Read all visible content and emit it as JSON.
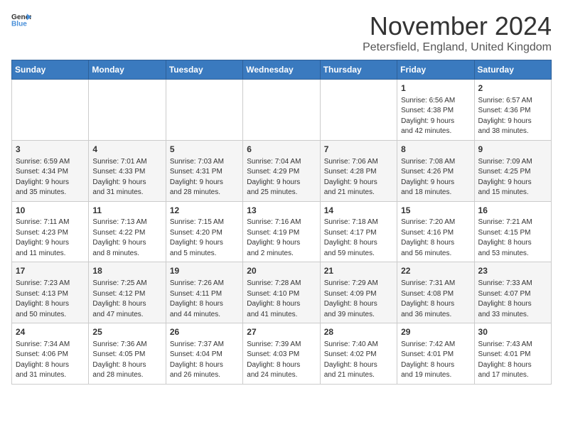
{
  "logo": {
    "text_general": "General",
    "text_blue": "Blue"
  },
  "title": "November 2024",
  "location": "Petersfield, England, United Kingdom",
  "headers": [
    "Sunday",
    "Monday",
    "Tuesday",
    "Wednesday",
    "Thursday",
    "Friday",
    "Saturday"
  ],
  "weeks": [
    [
      {
        "day": "",
        "info": ""
      },
      {
        "day": "",
        "info": ""
      },
      {
        "day": "",
        "info": ""
      },
      {
        "day": "",
        "info": ""
      },
      {
        "day": "",
        "info": ""
      },
      {
        "day": "1",
        "info": "Sunrise: 6:56 AM\nSunset: 4:38 PM\nDaylight: 9 hours\nand 42 minutes."
      },
      {
        "day": "2",
        "info": "Sunrise: 6:57 AM\nSunset: 4:36 PM\nDaylight: 9 hours\nand 38 minutes."
      }
    ],
    [
      {
        "day": "3",
        "info": "Sunrise: 6:59 AM\nSunset: 4:34 PM\nDaylight: 9 hours\nand 35 minutes."
      },
      {
        "day": "4",
        "info": "Sunrise: 7:01 AM\nSunset: 4:33 PM\nDaylight: 9 hours\nand 31 minutes."
      },
      {
        "day": "5",
        "info": "Sunrise: 7:03 AM\nSunset: 4:31 PM\nDaylight: 9 hours\nand 28 minutes."
      },
      {
        "day": "6",
        "info": "Sunrise: 7:04 AM\nSunset: 4:29 PM\nDaylight: 9 hours\nand 25 minutes."
      },
      {
        "day": "7",
        "info": "Sunrise: 7:06 AM\nSunset: 4:28 PM\nDaylight: 9 hours\nand 21 minutes."
      },
      {
        "day": "8",
        "info": "Sunrise: 7:08 AM\nSunset: 4:26 PM\nDaylight: 9 hours\nand 18 minutes."
      },
      {
        "day": "9",
        "info": "Sunrise: 7:09 AM\nSunset: 4:25 PM\nDaylight: 9 hours\nand 15 minutes."
      }
    ],
    [
      {
        "day": "10",
        "info": "Sunrise: 7:11 AM\nSunset: 4:23 PM\nDaylight: 9 hours\nand 11 minutes."
      },
      {
        "day": "11",
        "info": "Sunrise: 7:13 AM\nSunset: 4:22 PM\nDaylight: 9 hours\nand 8 minutes."
      },
      {
        "day": "12",
        "info": "Sunrise: 7:15 AM\nSunset: 4:20 PM\nDaylight: 9 hours\nand 5 minutes."
      },
      {
        "day": "13",
        "info": "Sunrise: 7:16 AM\nSunset: 4:19 PM\nDaylight: 9 hours\nand 2 minutes."
      },
      {
        "day": "14",
        "info": "Sunrise: 7:18 AM\nSunset: 4:17 PM\nDaylight: 8 hours\nand 59 minutes."
      },
      {
        "day": "15",
        "info": "Sunrise: 7:20 AM\nSunset: 4:16 PM\nDaylight: 8 hours\nand 56 minutes."
      },
      {
        "day": "16",
        "info": "Sunrise: 7:21 AM\nSunset: 4:15 PM\nDaylight: 8 hours\nand 53 minutes."
      }
    ],
    [
      {
        "day": "17",
        "info": "Sunrise: 7:23 AM\nSunset: 4:13 PM\nDaylight: 8 hours\nand 50 minutes."
      },
      {
        "day": "18",
        "info": "Sunrise: 7:25 AM\nSunset: 4:12 PM\nDaylight: 8 hours\nand 47 minutes."
      },
      {
        "day": "19",
        "info": "Sunrise: 7:26 AM\nSunset: 4:11 PM\nDaylight: 8 hours\nand 44 minutes."
      },
      {
        "day": "20",
        "info": "Sunrise: 7:28 AM\nSunset: 4:10 PM\nDaylight: 8 hours\nand 41 minutes."
      },
      {
        "day": "21",
        "info": "Sunrise: 7:29 AM\nSunset: 4:09 PM\nDaylight: 8 hours\nand 39 minutes."
      },
      {
        "day": "22",
        "info": "Sunrise: 7:31 AM\nSunset: 4:08 PM\nDaylight: 8 hours\nand 36 minutes."
      },
      {
        "day": "23",
        "info": "Sunrise: 7:33 AM\nSunset: 4:07 PM\nDaylight: 8 hours\nand 33 minutes."
      }
    ],
    [
      {
        "day": "24",
        "info": "Sunrise: 7:34 AM\nSunset: 4:06 PM\nDaylight: 8 hours\nand 31 minutes."
      },
      {
        "day": "25",
        "info": "Sunrise: 7:36 AM\nSunset: 4:05 PM\nDaylight: 8 hours\nand 28 minutes."
      },
      {
        "day": "26",
        "info": "Sunrise: 7:37 AM\nSunset: 4:04 PM\nDaylight: 8 hours\nand 26 minutes."
      },
      {
        "day": "27",
        "info": "Sunrise: 7:39 AM\nSunset: 4:03 PM\nDaylight: 8 hours\nand 24 minutes."
      },
      {
        "day": "28",
        "info": "Sunrise: 7:40 AM\nSunset: 4:02 PM\nDaylight: 8 hours\nand 21 minutes."
      },
      {
        "day": "29",
        "info": "Sunrise: 7:42 AM\nSunset: 4:01 PM\nDaylight: 8 hours\nand 19 minutes."
      },
      {
        "day": "30",
        "info": "Sunrise: 7:43 AM\nSunset: 4:01 PM\nDaylight: 8 hours\nand 17 minutes."
      }
    ]
  ]
}
